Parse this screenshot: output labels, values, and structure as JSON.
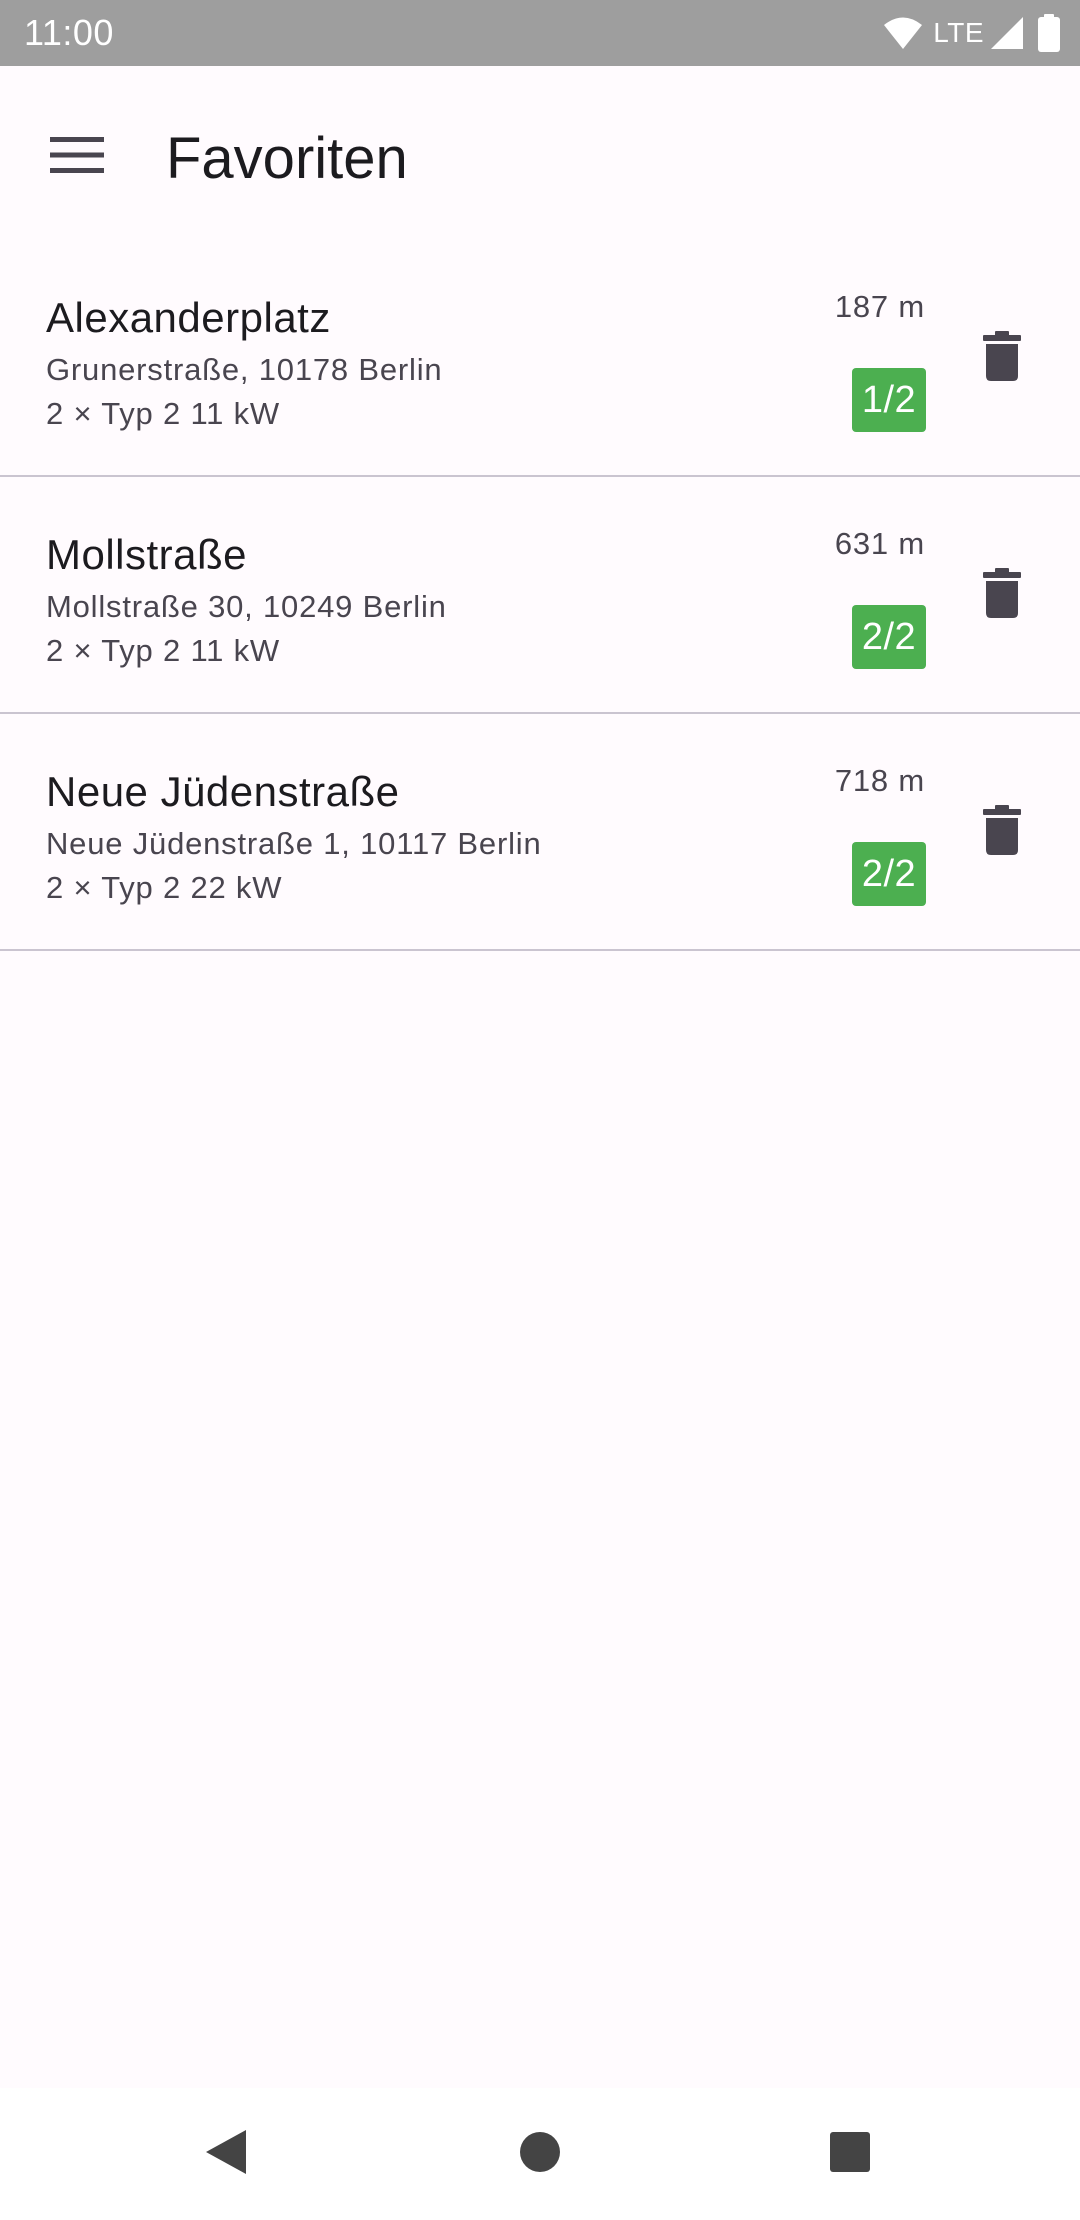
{
  "status_bar": {
    "time": "11:00",
    "network": "LTE",
    "icons": [
      "wifi-icon",
      "cell-signal-icon",
      "battery-icon"
    ]
  },
  "app_bar": {
    "title": "Favoriten",
    "menu_icon": "hamburger-menu-icon"
  },
  "favorites": [
    {
      "name": "Alexanderplatz",
      "address": "Grunerstraße, 10178 Berlin",
      "connectors": "2 × Typ 2 11 kW",
      "distance": "187 m",
      "availability": "1/2"
    },
    {
      "name": "Mollstraße",
      "address": "Mollstraße 30, 10249 Berlin",
      "connectors": "2 × Typ 2 11 kW",
      "distance": "631 m",
      "availability": "2/2"
    },
    {
      "name": "Neue Jüdenstraße",
      "address": "Neue Jüdenstraße 1, 10117 Berlin",
      "connectors": "2 × Typ 2 22 kW",
      "distance": "718 m",
      "availability": "2/2"
    }
  ],
  "item_actions": {
    "delete_icon": "trash-icon"
  },
  "nav_bar": {
    "icons": [
      "back-icon",
      "home-icon",
      "recents-icon"
    ]
  },
  "colors": {
    "background": "#FFFBFE",
    "status_bar": "#9E9E9E",
    "availability_badge": "#4CAF50",
    "divider": "#CAC4D0",
    "icon": "#49454F"
  }
}
